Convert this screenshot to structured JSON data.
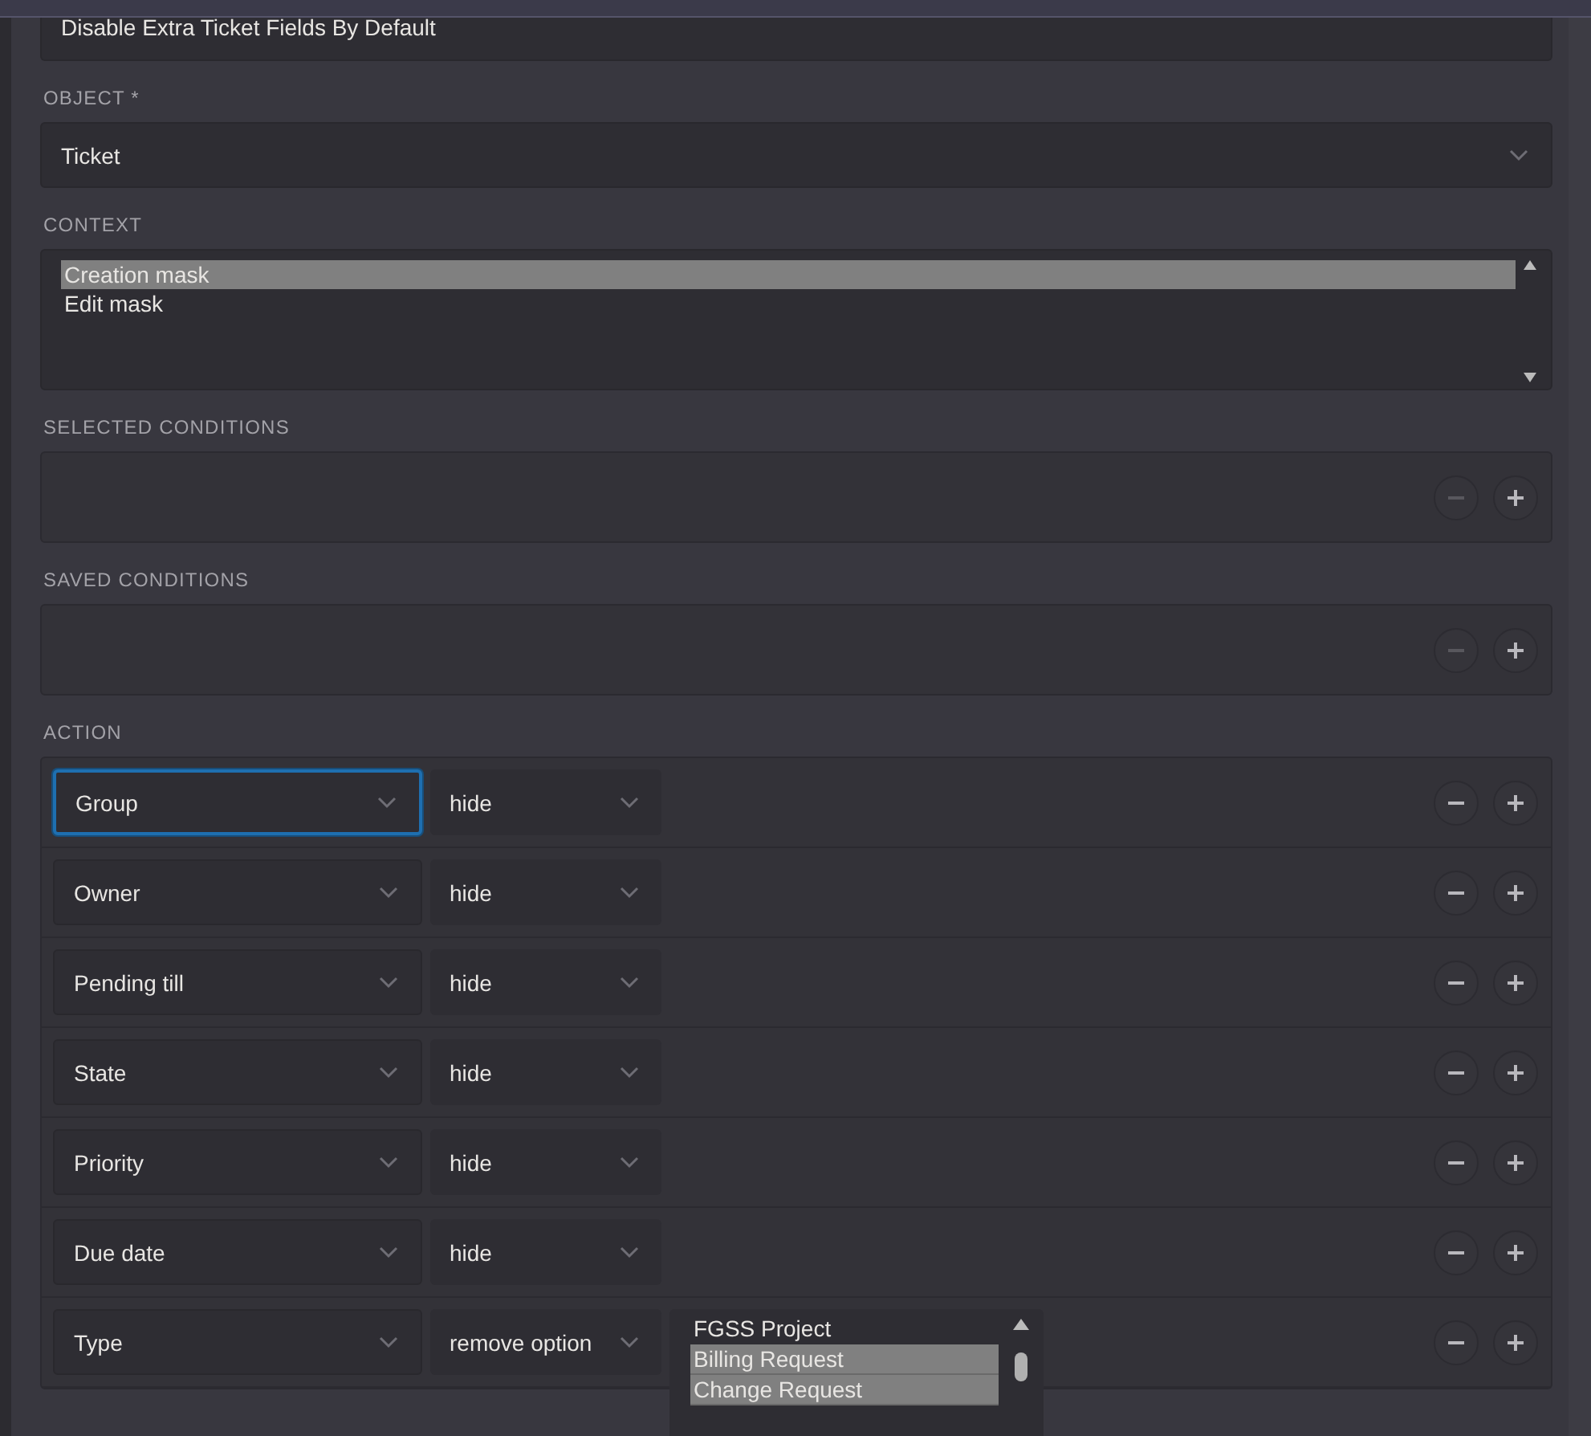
{
  "name_field": {
    "value": "Disable Extra Ticket Fields By Default"
  },
  "object": {
    "label": "OBJECT *",
    "value": "Ticket"
  },
  "context": {
    "label": "CONTEXT",
    "options": [
      {
        "label": "Creation mask",
        "selected": true
      },
      {
        "label": "Edit mask",
        "selected": false
      }
    ]
  },
  "selected_conditions": {
    "label": "SELECTED CONDITIONS",
    "remove_disabled": true
  },
  "saved_conditions": {
    "label": "SAVED CONDITIONS",
    "remove_disabled": true
  },
  "action": {
    "label": "ACTION",
    "rows": [
      {
        "field": "Group",
        "operator": "hide",
        "focused": true
      },
      {
        "field": "Owner",
        "operator": "hide",
        "focused": false
      },
      {
        "field": "Pending till",
        "operator": "hide",
        "focused": false
      },
      {
        "field": "State",
        "operator": "hide",
        "focused": false
      },
      {
        "field": "Priority",
        "operator": "hide",
        "focused": false
      },
      {
        "field": "Due date",
        "operator": "hide",
        "focused": false
      },
      {
        "field": "Type",
        "operator": "remove option",
        "focused": false,
        "options": [
          {
            "label": "FGSS Project",
            "selected": false
          },
          {
            "label": "Billing Request",
            "selected": true
          },
          {
            "label": "Change Request",
            "selected": true
          }
        ]
      }
    ]
  }
}
